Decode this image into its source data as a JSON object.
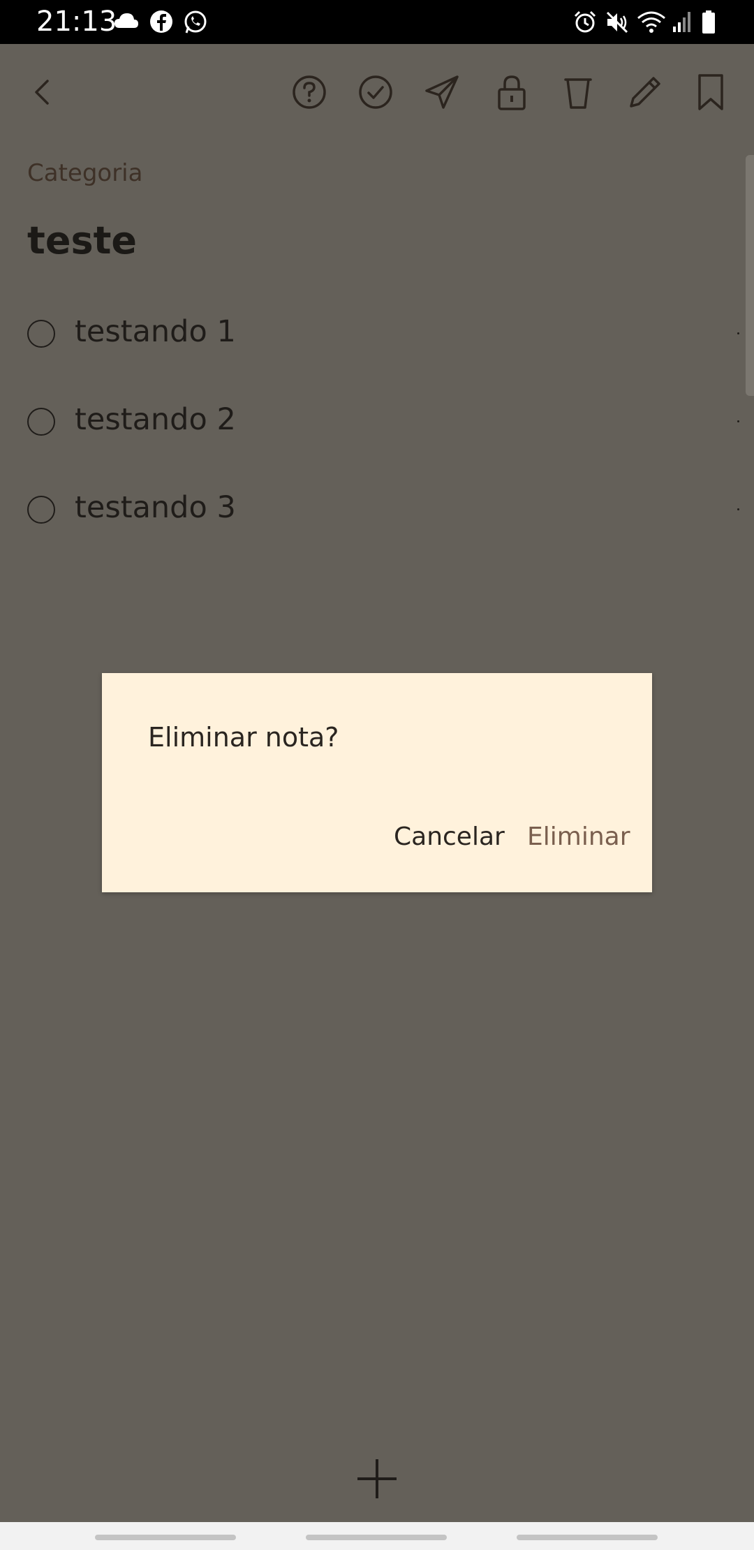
{
  "status_bar": {
    "time": "21:13",
    "left_icons": [
      "cloud-icon",
      "facebook-icon",
      "whatsapp-icon"
    ],
    "right_icons": [
      "alarm-icon",
      "mute-icon",
      "wifi-icon",
      "signal-icon",
      "battery-icon"
    ]
  },
  "toolbar": {
    "icons": [
      "back-icon",
      "help-icon",
      "check-circle-icon",
      "send-icon",
      "lock-icon",
      "trash-icon",
      "edit-icon",
      "bookmark-icon"
    ]
  },
  "note": {
    "category": "Categoria",
    "title": "teste",
    "items": [
      {
        "text": "testando 1",
        "checked": false
      },
      {
        "text": "testando 2",
        "checked": false
      },
      {
        "text": "testando 3",
        "checked": false
      }
    ]
  },
  "dialog": {
    "title": "Eliminar nota?",
    "cancel_label": "Cancelar",
    "confirm_label": "Eliminar"
  },
  "colors": {
    "background_dimmed": "#646059",
    "dialog_background": "#fff2dc",
    "accent_text": "#7a5f4e",
    "category_text": "#3e3127"
  }
}
